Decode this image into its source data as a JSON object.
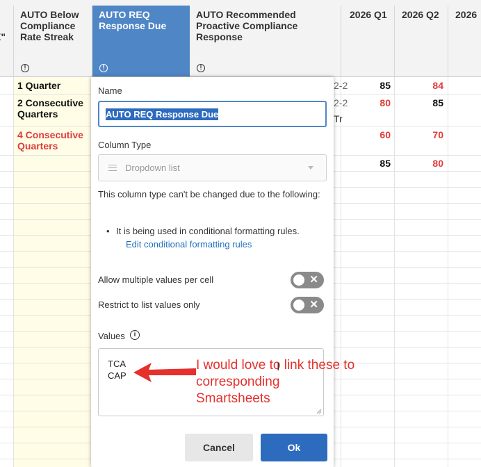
{
  "grid": {
    "headers": {
      "col_x": "X\"",
      "col_streak": "AUTO Below Compliance Rate Streak",
      "col_req": "AUTO REQ Response Due",
      "col_rec": "AUTO Recommended Proactive Compliance Response",
      "col_q1": "2026 Q1",
      "col_q2": "2026 Q2",
      "col_next": "2026"
    },
    "rows": [
      {
        "streak": "1 Quarter",
        "q1": "85",
        "q2": "84",
        "partial": "2-2"
      },
      {
        "streak": "2 Consecutive Quarters",
        "q1": "80",
        "q2": "85",
        "partial": "2-2",
        "partial2": "Tr"
      },
      {
        "streak": "4 Consecutive Quarters",
        "q1": "60",
        "q2": "70"
      },
      {
        "streak": "",
        "q1": "85",
        "q2": "80"
      }
    ],
    "colors": {
      "red": "#e03b3b",
      "header_bg": "#f3f3f3",
      "selected_header": "#4f86c6",
      "shade": "#fffde6"
    }
  },
  "dialog": {
    "name_label": "Name",
    "name_value": "AUTO REQ Response Due",
    "column_type_label": "Column Type",
    "column_type_value": "Dropdown list",
    "note": "This column type can't be changed due to the following:",
    "bullet": "It is being used in conditional formatting rules.",
    "link": "Edit conditional formatting rules",
    "toggle_multi": "Allow multiple values per cell",
    "toggle_restrict": "Restrict to list values only",
    "values_label": "Values",
    "values": [
      "TCA",
      "CAP"
    ],
    "cancel": "Cancel",
    "ok": "Ok",
    "accent": "#2d6bbf"
  },
  "annotation": {
    "text": "I would love to link these to corresponding Smartsheets",
    "color": "#e5302c"
  }
}
